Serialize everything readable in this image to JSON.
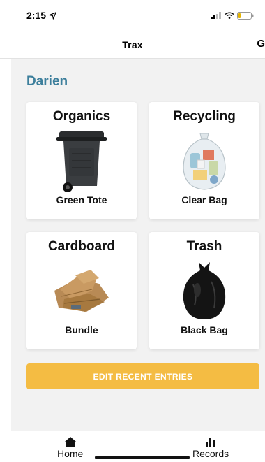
{
  "status": {
    "time": "2:15",
    "location_icon": "location-arrow-icon",
    "signal_icon": "signal-bars-icon",
    "wifi_icon": "wifi-icon",
    "battery_icon": "battery-icon"
  },
  "nav": {
    "title": "Trax",
    "right_label": "G"
  },
  "location": "Darien",
  "cards": [
    {
      "title": "Organics",
      "subtitle": "Green Tote",
      "icon": "green-tote-bin-icon"
    },
    {
      "title": "Recycling",
      "subtitle": "Clear Bag",
      "icon": "clear-bag-icon"
    },
    {
      "title": "Cardboard",
      "subtitle": "Bundle",
      "icon": "cardboard-bundle-icon"
    },
    {
      "title": "Trash",
      "subtitle": "Black Bag",
      "icon": "black-bag-icon"
    }
  ],
  "edit_button": "EDIT RECENT ENTRIES",
  "tabs": {
    "home": {
      "label": "Home",
      "icon": "home-icon"
    },
    "records": {
      "label": "Records",
      "icon": "bar-chart-icon"
    }
  },
  "colors": {
    "accent_location": "#3d7f9c",
    "button": "#f4bc43",
    "background": "#f2f2f2"
  }
}
